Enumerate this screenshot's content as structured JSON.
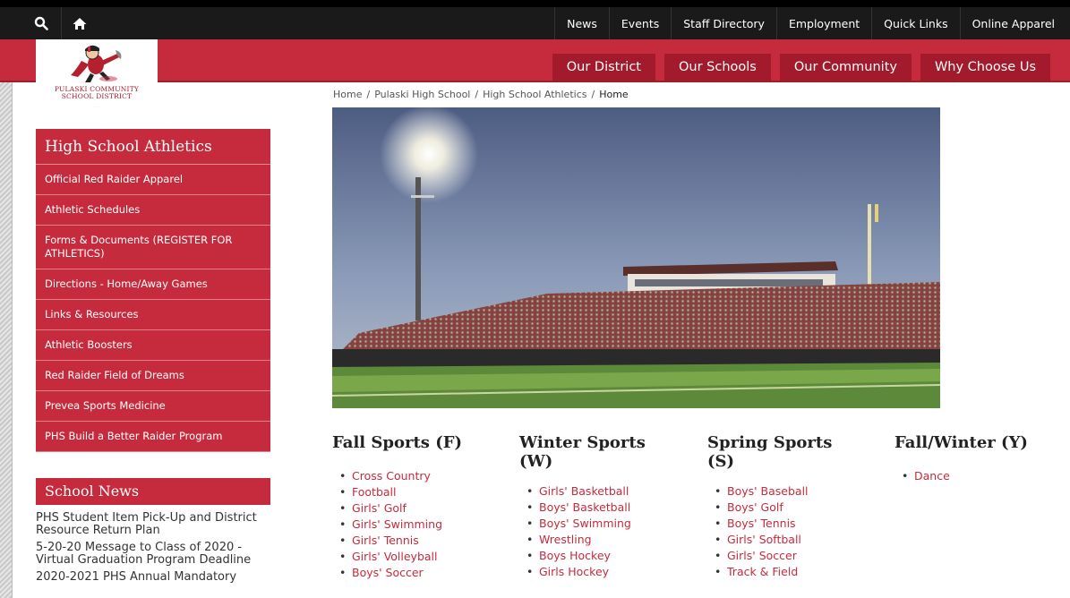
{
  "topbar": {
    "links": [
      "News",
      "Events",
      "Staff Directory",
      "Employment",
      "Quick Links",
      "Online Apparel"
    ]
  },
  "mainnav": {
    "links": [
      "Our District",
      "Our Schools",
      "Our Community",
      "Why Choose Us"
    ]
  },
  "logo": {
    "line1": "PULASKI COMMUNITY",
    "line2": "SCHOOL DISTRICT"
  },
  "breadcrumb": {
    "items": [
      "Home",
      "Pulaski High School",
      "High School Athletics"
    ],
    "current": "Home"
  },
  "sidebar": {
    "title": "High School Athletics",
    "items": [
      "Official Red Raider Apparel",
      "Athletic Schedules",
      "Forms & Documents (REGISTER FOR ATHLETICS)",
      "Directions - Home/Away Games",
      "Links & Resources",
      "Athletic Boosters",
      "Red Raider Field of Dreams",
      "Prevea Sports Medicine",
      "PHS Build a Better Raider Program"
    ]
  },
  "news": {
    "title": "School News",
    "items": [
      "PHS Student Item Pick-Up and District Resource Return Plan",
      "5-20-20 Message to Class of 2020 - Virtual Graduation Program Deadline",
      "2020-2021 PHS Annual Mandatory"
    ]
  },
  "sports": {
    "columns": [
      {
        "title": "Fall Sports (F)",
        "items": [
          "Cross Country",
          "Football",
          "Girls' Golf",
          "Girls' Swimming",
          "Girls' Tennis",
          "Girls' Volleyball",
          "Boys' Soccer"
        ]
      },
      {
        "title": "Winter Sports (W)",
        "items": [
          "Girls' Basketball",
          "Boys' Basketball",
          "Boys' Swimming",
          "Wrestling",
          "Boys Hockey",
          "Girls Hockey"
        ]
      },
      {
        "title": "Spring Sports (S)",
        "items": [
          "Boys' Baseball",
          "Boys' Golf",
          "Boys' Tennis",
          "Girls' Softball",
          "Girls' Soccer",
          "Track & Field"
        ]
      },
      {
        "title": "Fall/Winter (Y)",
        "items": [
          "Dance"
        ]
      }
    ]
  },
  "colors": {
    "brand_red": "#c52b3d",
    "dark_red": "#a21a2c",
    "topbar": "#1a1a1a"
  },
  "icons": {
    "search": "search-icon",
    "home": "home-icon",
    "logo": "red-raider-mascot-icon"
  }
}
